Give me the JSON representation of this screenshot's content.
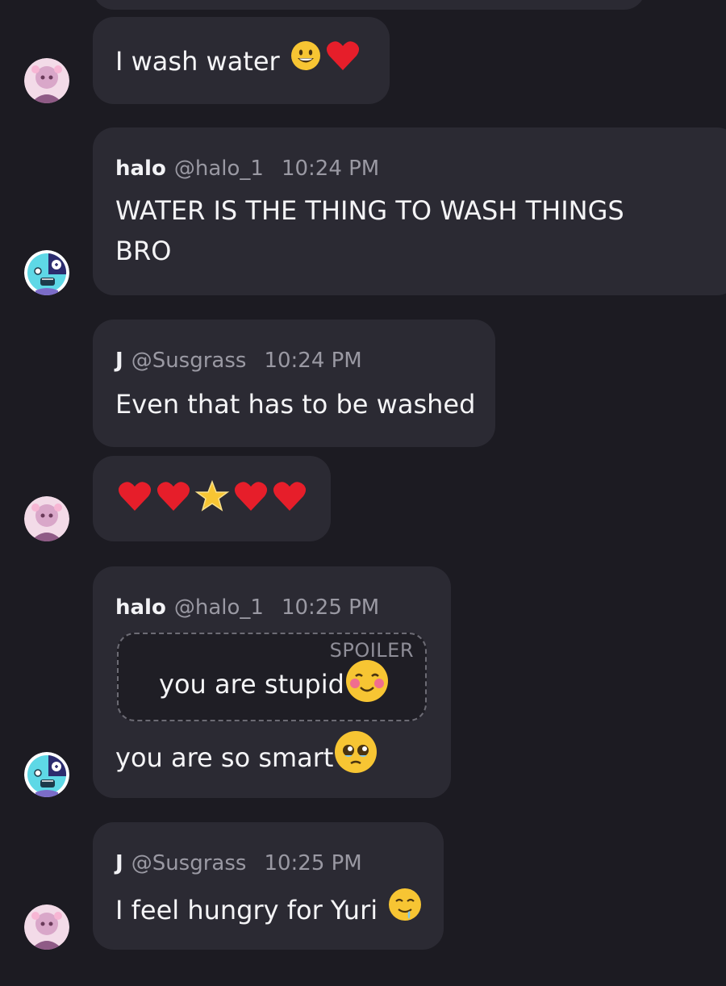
{
  "messages": [
    {
      "text": "I wash water",
      "emojis": [
        "grinning-face",
        "red-heart"
      ]
    },
    {
      "name": "halo",
      "handle": "@halo_1",
      "time": "10:24 PM",
      "line1": "WATER IS THE THING TO WASH THINGS",
      "line2": "BRO"
    },
    {
      "name": "J",
      "handle": "@Susgrass",
      "time": "10:24 PM",
      "text": "Even that has to be washed"
    },
    {
      "emojis": [
        "red-heart",
        "red-heart",
        "glowing-star",
        "red-heart",
        "red-heart"
      ]
    },
    {
      "name": "halo",
      "handle": "@halo_1",
      "time": "10:25 PM",
      "spoiler_label": "SPOILER",
      "spoiler_text": "you are stupid",
      "text": "you are so smart"
    },
    {
      "name": "J",
      "handle": "@Susgrass",
      "time": "10:25 PM",
      "text": "I feel hungry for Yuri"
    }
  ],
  "colors": {
    "background": "#1c1b22",
    "bubble": "#2b2a33",
    "muted_text": "#9a99a3",
    "accent_avatar": "#5ed8e6"
  }
}
